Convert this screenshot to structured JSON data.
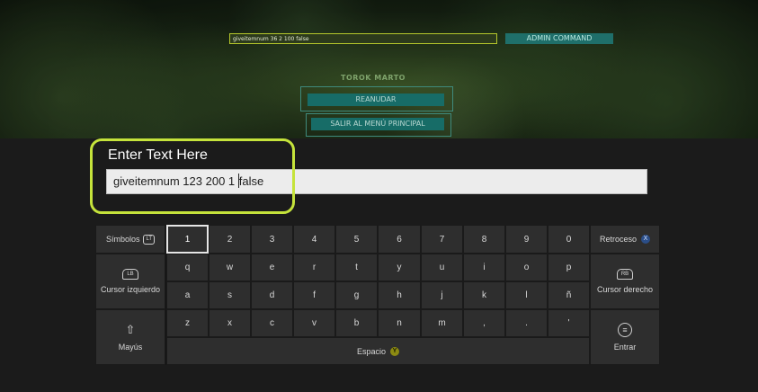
{
  "game": {
    "command_value": "giveitemnum 36 2 100 false",
    "command_button": "ADMIN COMMAND",
    "player_name": "TOROK MARTO",
    "resume_button": "REANUDAR",
    "main_menu_button": "SALIR AL MENÚ PRINCIPAL"
  },
  "entry": {
    "prompt": "Enter Text Here",
    "value_before_caret": "giveitemnum 123 200 1 ",
    "value_after_caret": "false"
  },
  "keyboard": {
    "symbols_label": "Símbolos",
    "symbols_icon": "LT",
    "backspace_label": "Retroceso",
    "backspace_badge": "X",
    "cursor_left_label": "Cursor izquierdo",
    "cursor_left_icon": "LB",
    "cursor_right_label": "Cursor derecho",
    "cursor_right_icon": "RB",
    "shift_label": "Mayús",
    "shift_icon": "⇧",
    "space_label": "Espacio",
    "space_badge": "Y",
    "enter_label": "Entrar",
    "enter_icon": "≡",
    "row1": [
      "1",
      "2",
      "3",
      "4",
      "5",
      "6",
      "7",
      "8",
      "9",
      "0"
    ],
    "row2": [
      "q",
      "w",
      "e",
      "r",
      "t",
      "y",
      "u",
      "i",
      "o",
      "p"
    ],
    "row3": [
      "a",
      "s",
      "d",
      "f",
      "g",
      "h",
      "j",
      "k",
      "l",
      "ñ"
    ],
    "row4": [
      "z",
      "x",
      "c",
      "v",
      "b",
      "n",
      "m",
      ",",
      ".",
      "'"
    ]
  },
  "colors": {
    "highlight": "#c5e33b",
    "x_badge": "#2b4e88",
    "y_badge": "#8c8a12"
  }
}
